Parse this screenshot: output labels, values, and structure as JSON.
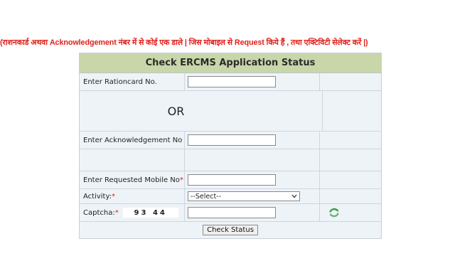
{
  "notice": "(राशनकार्ड अथवा Acknowledgement नंबर में से कोई एक डाले | जिस मोबाइल से Request किये हैं , तथा एक्टिविटी सेलेक्ट करें |)",
  "form": {
    "title": "Check ERCMS Application Status",
    "rationcard_label": "Enter Rationcard No.",
    "rationcard_value": "",
    "or_text": "OR",
    "ack_label": "Enter Acknowledgement No",
    "ack_value": "",
    "mobile_label": "Enter Requested Mobile No",
    "mobile_value": "",
    "required_mark": "*",
    "activity_label": "Activity:",
    "activity_selected": "--Select--",
    "captcha_label": "Captcha:",
    "captcha_code": "93 44",
    "captcha_value": "",
    "submit_label": "Check Status"
  },
  "colors": {
    "notice_text": "#e0201a",
    "title_bg": "#c9d6a9",
    "panel_bg": "#eef3f8",
    "refresh_icon": "#3aa14a"
  },
  "icons": [
    "chevron-down-icon",
    "refresh-icon"
  ]
}
